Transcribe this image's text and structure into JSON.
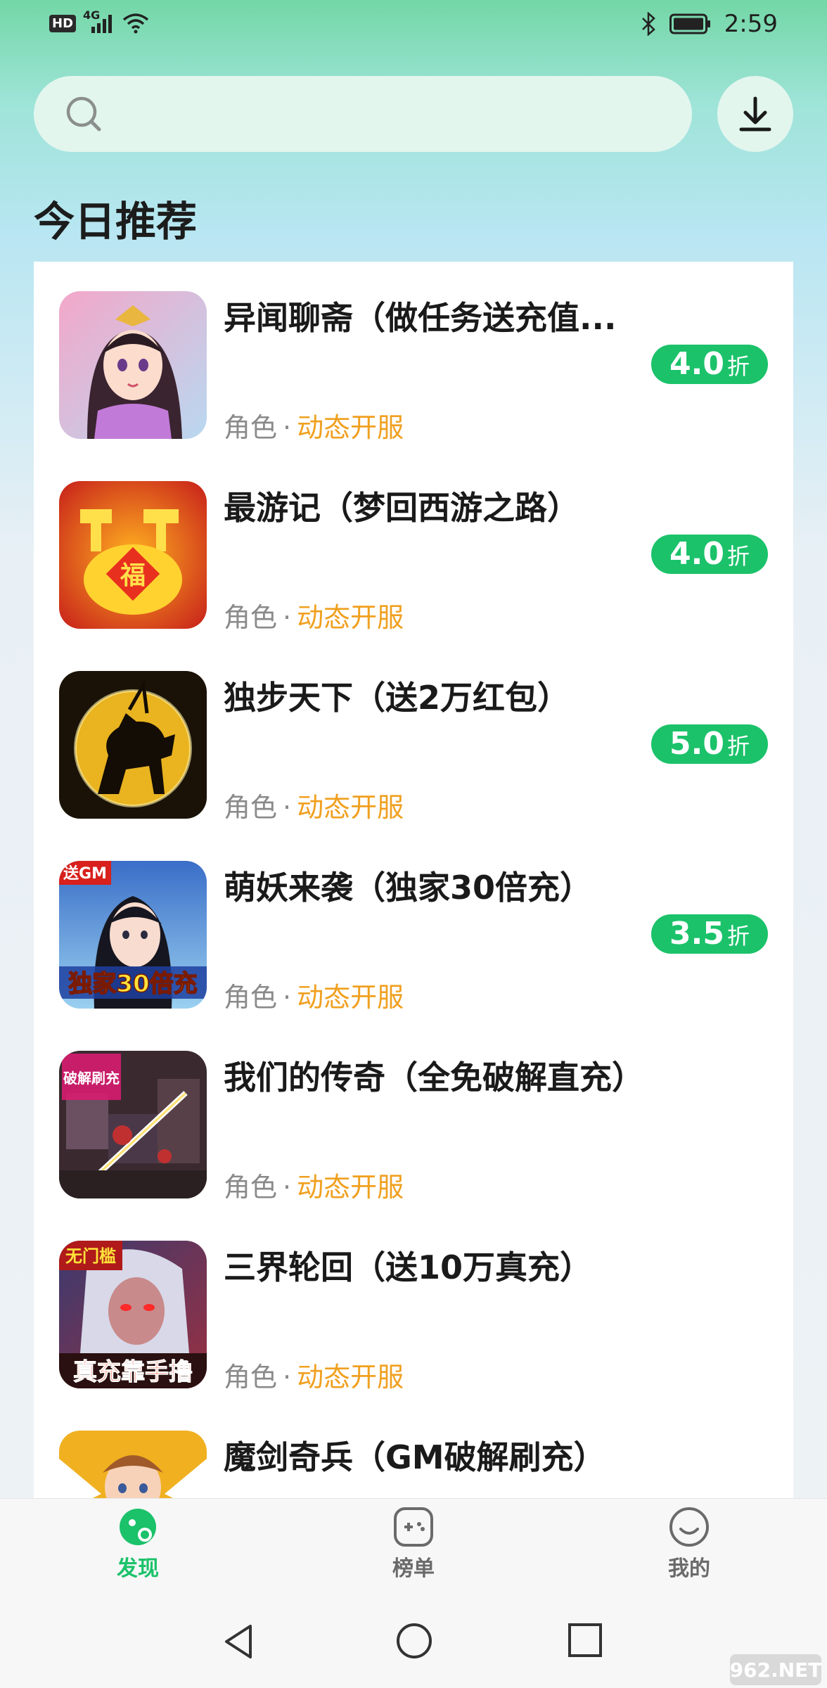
{
  "status_bar": {
    "network_badge": "HD",
    "network_type": "4G",
    "time": "2:59"
  },
  "search": {
    "placeholder": ""
  },
  "section_title": "今日推荐",
  "games": [
    {
      "name": "异闻聊斋（做任务送充值...",
      "genre": "角色",
      "separator": "·",
      "server": "动态开服",
      "discount": "4.0",
      "discount_unit": "折"
    },
    {
      "name": "最游记（梦回西游之路）",
      "genre": "角色",
      "separator": "·",
      "server": "动态开服",
      "discount": "4.0",
      "discount_unit": "折"
    },
    {
      "name": "独步天下（送2万红包）",
      "genre": "角色",
      "separator": "·",
      "server": "动态开服",
      "discount": "5.0",
      "discount_unit": "折"
    },
    {
      "name": "萌妖来袭（独家30倍充）",
      "genre": "角色",
      "separator": "·",
      "server": "动态开服",
      "discount": "3.5",
      "discount_unit": "折"
    },
    {
      "name": "我们的传奇（全免破解直充）",
      "genre": "角色",
      "separator": "·",
      "server": "动态开服"
    },
    {
      "name": "三界轮回（送10万真充）",
      "genre": "角色",
      "separator": "·",
      "server": "动态开服"
    },
    {
      "name": "魔剑奇兵（GM破解刷充）"
    }
  ],
  "icon_texts": {
    "game4_badge": "送GM",
    "game4_banner": "独家30倍充",
    "game5_banner": "破解刷充",
    "game6_top": "无门槛",
    "game6_bottom": "真充靠手撸",
    "game2_char": "福"
  },
  "bottom_nav": [
    {
      "label": "发现",
      "icon": "discover-icon",
      "active": true
    },
    {
      "label": "榜单",
      "icon": "gamepad-icon",
      "active": false
    },
    {
      "label": "我的",
      "icon": "smile-icon",
      "active": false
    }
  ],
  "watermark": "962.NET",
  "colors": {
    "accent": "#1bc26a",
    "server_text": "#f0a020",
    "header_green": "#73d7a6"
  }
}
